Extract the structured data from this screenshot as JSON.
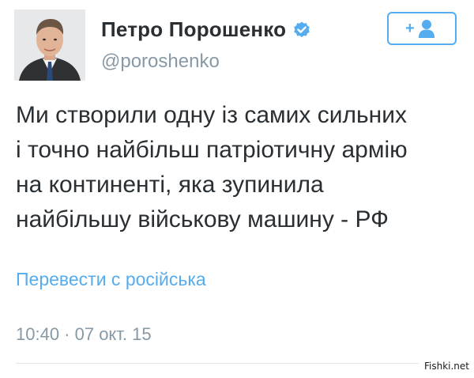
{
  "user": {
    "display_name": "Петро Порошенко",
    "handle": "@poroshenko",
    "verified": true
  },
  "follow_button": {
    "icon": "add-user-icon",
    "label": "+"
  },
  "tweet": {
    "text": "Ми створили одну із самих сильних\nі точно найбільш патріотичну армію\nна континенті, яка зупинила\nнайбільшу військову машину - РФ",
    "translate_label": "Перевести с російська",
    "timestamp": "10:40 · 07 окт. 15"
  },
  "watermark": "Fishki.net",
  "colors": {
    "accent": "#55acee",
    "text": "#292f33",
    "muted": "#8899a6",
    "divider": "#e1e8ed"
  }
}
